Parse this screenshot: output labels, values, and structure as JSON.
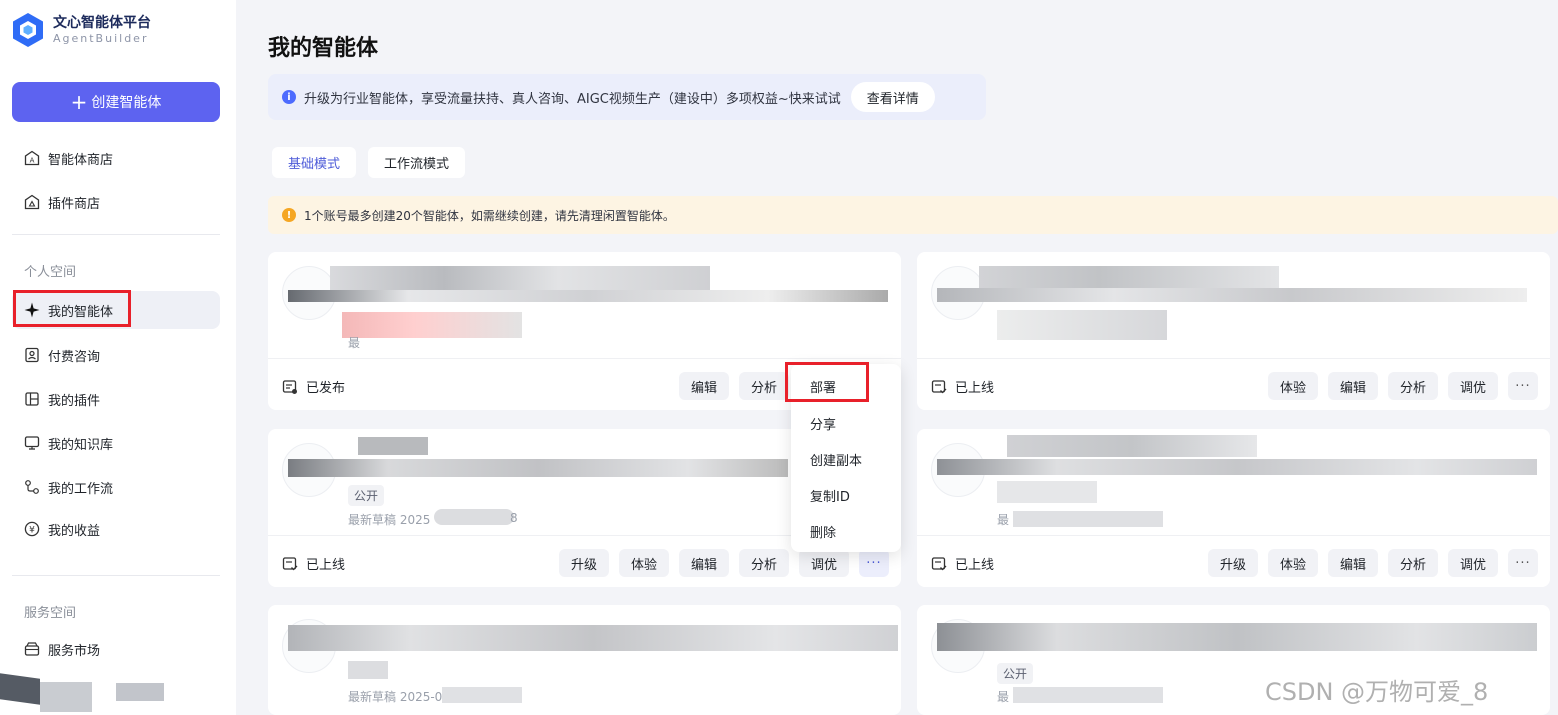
{
  "app": {
    "title": "文心智能体平台",
    "subtitle": "AgentBuilder"
  },
  "sidebar": {
    "create_label": "创建智能体",
    "top_items": [
      {
        "label": "智能体商店",
        "icon": "store-icon"
      },
      {
        "label": "插件商店",
        "icon": "plugin-store-icon"
      }
    ],
    "personal_label": "个人空间",
    "personal_items": [
      {
        "label": "我的智能体",
        "icon": "sparkle-icon",
        "active": true
      },
      {
        "label": "付费咨询",
        "icon": "consult-icon"
      },
      {
        "label": "我的插件",
        "icon": "plugin-icon"
      },
      {
        "label": "我的知识库",
        "icon": "knowledge-icon"
      },
      {
        "label": "我的工作流",
        "icon": "workflow-icon"
      },
      {
        "label": "我的收益",
        "icon": "yen-icon"
      }
    ],
    "service_label": "服务空间",
    "service_items": [
      {
        "label": "服务市场",
        "icon": "market-icon"
      }
    ]
  },
  "main": {
    "title": "我的智能体",
    "promo": {
      "text": "升级为行业智能体，享受流量扶持、真人咨询、AIGC视频生产（建设中）多项权益~快来试试",
      "button": "查看详情"
    },
    "modes": [
      "基础模式",
      "工作流模式"
    ],
    "warning": "1个账号最多创建20个智能体，如需继续创建，请先清理闲置智能体。",
    "cards": [
      {
        "status": "已发布",
        "tag": "",
        "meta": "最",
        "actions": [
          "编辑",
          "分析"
        ]
      },
      {
        "status": "已上线",
        "tag": "",
        "meta": "",
        "actions": [
          "体验",
          "编辑",
          "分析",
          "调优"
        ]
      },
      {
        "status": "已上线",
        "tag": "公开",
        "meta": "最新草稿 2025",
        "meta_end": "8",
        "actions": [
          "升级",
          "体验",
          "编辑",
          "分析",
          "调优"
        ]
      },
      {
        "status": "已上线",
        "tag": "",
        "meta": "最",
        "actions": [
          "升级",
          "体验",
          "编辑",
          "分析",
          "调优"
        ]
      },
      {
        "status": "",
        "tag": "",
        "meta": "最新草稿 2025-02",
        "actions": []
      },
      {
        "status": "",
        "tag": "公开",
        "meta": "最",
        "actions": []
      }
    ],
    "more_label": "···"
  },
  "dropdown": {
    "items": [
      "部署",
      "分享",
      "创建副本",
      "复制ID",
      "删除"
    ]
  },
  "watermark": "CSDN @万物可爱_8",
  "colors": {
    "accent": "#5d63f0",
    "highlight_frame": "#e8202a",
    "warning_bg": "#fdf4e3",
    "promo_bg": "#ebeefb"
  }
}
